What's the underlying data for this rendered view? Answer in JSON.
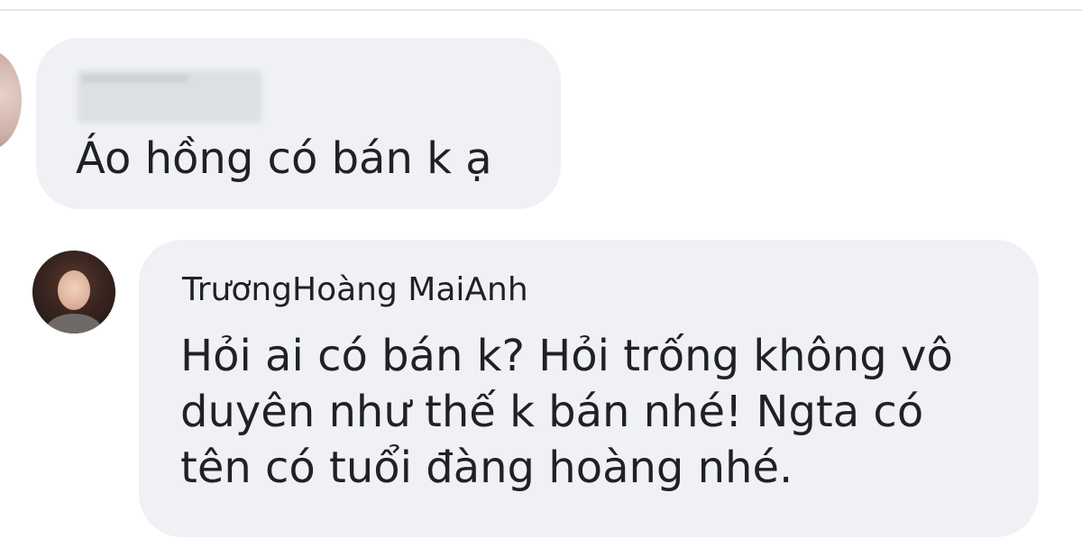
{
  "comments": [
    {
      "author": "",
      "message": "Áo hồng có bán k ạ"
    },
    {
      "author": "TrươngHoàng MaiAnh",
      "message_lines": [
        "Hỏi ai có bán k? Hỏi trống không vô",
        "duyên như thế k bán nhé! Ngta có",
        "tên có tuổi đàng hoàng nhé."
      ]
    }
  ]
}
